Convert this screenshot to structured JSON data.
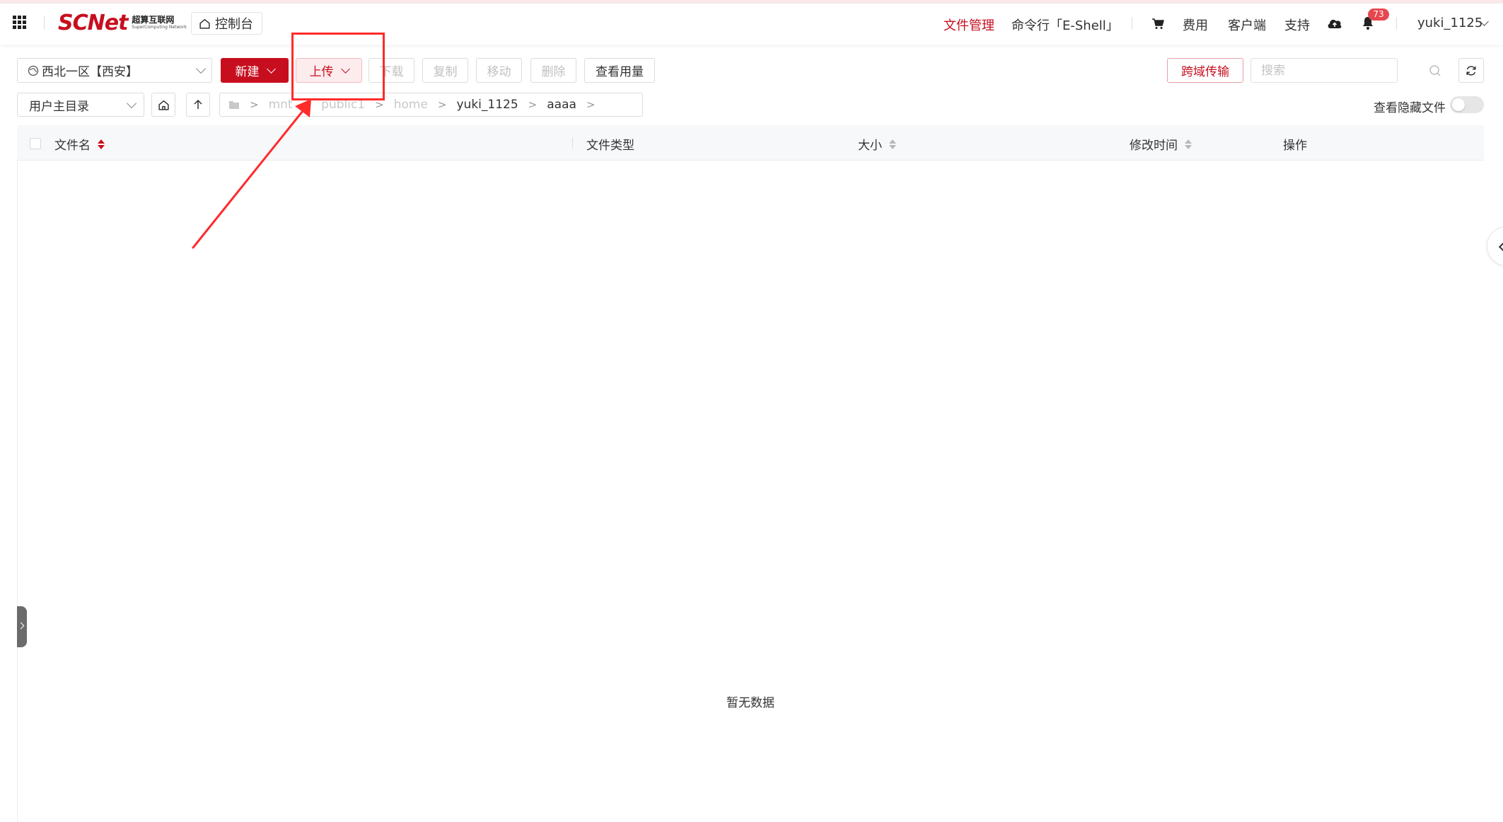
{
  "topbar": {
    "brand": {
      "name": "SCNet",
      "cn_name": "超算互联网",
      "en_name": "SuperComputing Network"
    },
    "console_label": "控制台",
    "nav": {
      "file_manager": "文件管理",
      "eshell": "命令行「E-Shell」",
      "fees": "费用",
      "client": "客户端",
      "support": "支持"
    },
    "notification_count": "73",
    "username": "yuki_1125"
  },
  "toolbar": {
    "region": "西北一区【西安】",
    "new_label": "新建",
    "upload_label": "上传",
    "download_label": "下载",
    "copy_label": "复制",
    "move_label": "移动",
    "delete_label": "删除",
    "usage_label": "查看用量",
    "cross_domain_label": "跨域传输",
    "search_placeholder": "搜索"
  },
  "pathbar": {
    "dir_select": "用户主目录",
    "breadcrumb": [
      "mnt",
      "public1",
      "home",
      "yuki_1125",
      "aaaa"
    ],
    "hidden_files_label": "查看隐藏文件"
  },
  "table": {
    "columns": {
      "name": "文件名",
      "type": "文件类型",
      "size": "大小",
      "mtime": "修改时间",
      "actions": "操作"
    },
    "rows": [],
    "empty_text": "暂无数据"
  },
  "colors": {
    "brand_red": "#c70e1e",
    "annotation_red": "#ff2b2b",
    "badge_red": "#e6474f"
  }
}
